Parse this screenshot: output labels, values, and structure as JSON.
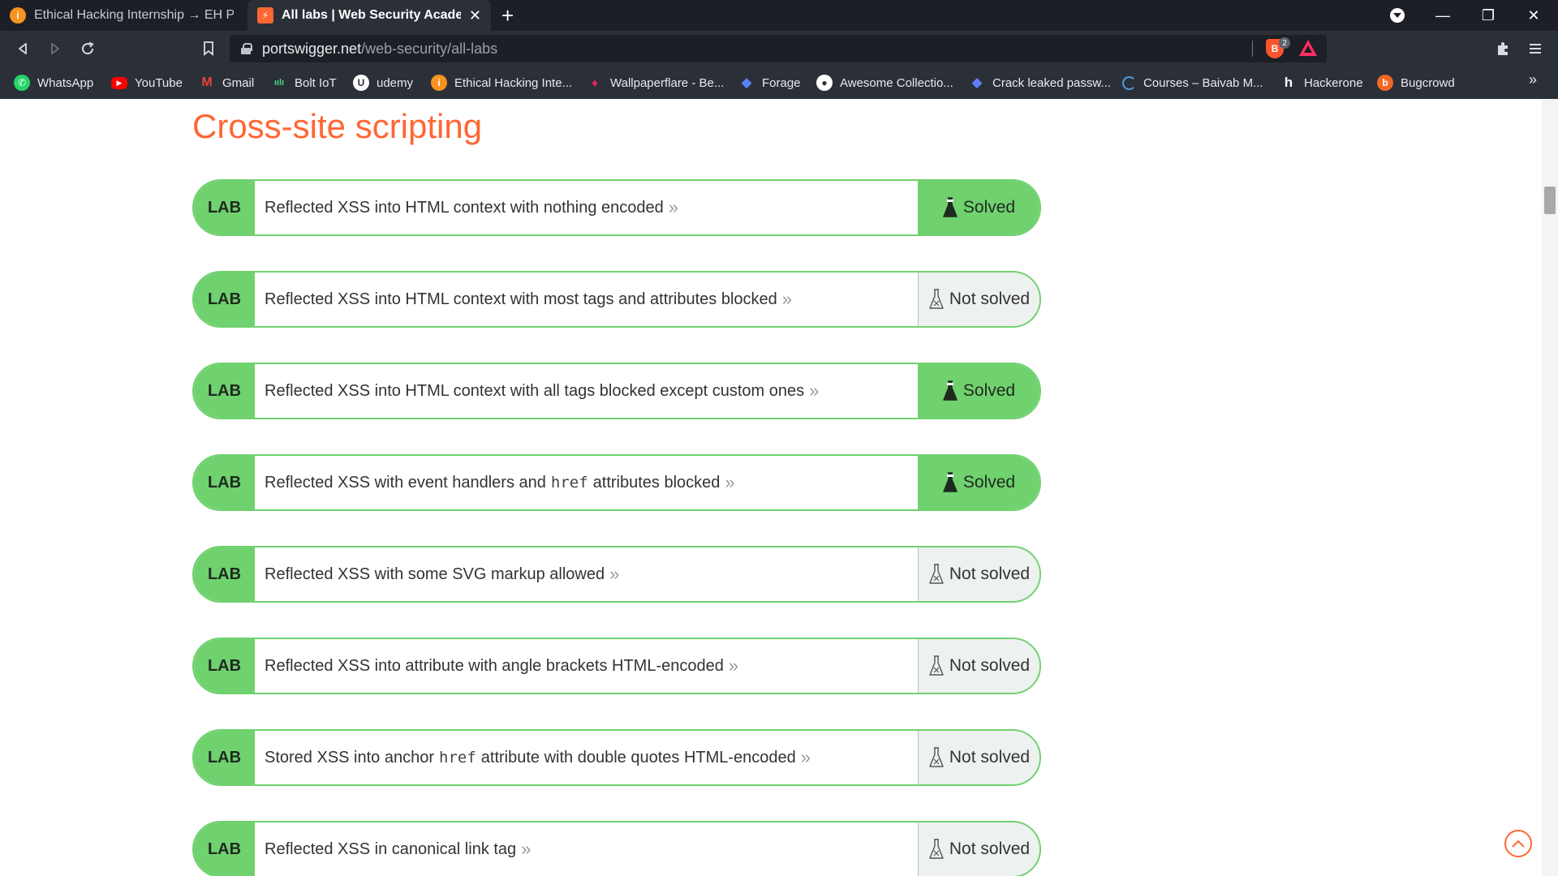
{
  "tabs": [
    {
      "title": "Ethical Hacking Internship → EH Projects",
      "icon": "internshala-icon"
    },
    {
      "title": "All labs | Web Security Academy",
      "icon": "portswigger-icon"
    }
  ],
  "tab_close": "✕",
  "new_tab": "+",
  "window": {
    "minimize": "—",
    "restore": "❐",
    "close": "✕"
  },
  "address": {
    "domain": "portswigger.net",
    "path": "/web-security/all-labs"
  },
  "extensions": {
    "brave_count": "2"
  },
  "bookmarks": [
    {
      "label": "WhatsApp",
      "icon": "whatsapp-icon",
      "color": "#25d366"
    },
    {
      "label": "YouTube",
      "icon": "youtube-icon",
      "color": "#ff0000"
    },
    {
      "label": "Gmail",
      "icon": "gmail-icon",
      "color": "#ea4335"
    },
    {
      "label": "Bolt IoT",
      "icon": "bolt-iot-icon",
      "color": "#3ddc84"
    },
    {
      "label": "udemy",
      "icon": "udemy-icon",
      "color": "#ffffff"
    },
    {
      "label": "Ethical Hacking Inte...",
      "icon": "internshala-icon",
      "color": "#f7931e"
    },
    {
      "label": "Wallpaperflare - Be...",
      "icon": "wallpaperflare-icon",
      "color": "#e0245e"
    },
    {
      "label": "Forage",
      "icon": "forage-icon",
      "color": "#5b7ff5"
    },
    {
      "label": "Awesome Collectio...",
      "icon": "github-icon",
      "color": "#ffffff"
    },
    {
      "label": "Crack leaked passw...",
      "icon": "crack-icon",
      "color": "#5b7ff5"
    },
    {
      "label": "Courses – Baivab M...",
      "icon": "courses-icon",
      "color": "#4a9de0"
    },
    {
      "label": "Hackerone",
      "icon": "hackerone-icon",
      "color": "#ffffff"
    },
    {
      "label": "Bugcrowd",
      "icon": "bugcrowd-icon",
      "color": "#f26822"
    }
  ],
  "bookmarks_more": "»",
  "section_title": "Cross-site scripting",
  "lab_tag": "LAB",
  "status_labels": {
    "solved": "Solved",
    "unsolved": "Not solved"
  },
  "labs": [
    {
      "parts": [
        {
          "t": "text",
          "v": "Reflected XSS into HTML context with nothing encoded"
        }
      ],
      "solved": true
    },
    {
      "parts": [
        {
          "t": "text",
          "v": "Reflected XSS into HTML context with most tags and attributes blocked"
        }
      ],
      "solved": false
    },
    {
      "parts": [
        {
          "t": "text",
          "v": "Reflected XSS into HTML context with all tags blocked except custom ones"
        }
      ],
      "solved": true
    },
    {
      "parts": [
        {
          "t": "text",
          "v": "Reflected XSS with event handlers and"
        },
        {
          "t": "code",
          "v": "href"
        },
        {
          "t": "text",
          "v": "attributes blocked"
        }
      ],
      "solved": true
    },
    {
      "parts": [
        {
          "t": "text",
          "v": "Reflected XSS with some SVG markup allowed"
        }
      ],
      "solved": false
    },
    {
      "parts": [
        {
          "t": "text",
          "v": "Reflected XSS into attribute with angle brackets HTML-encoded"
        }
      ],
      "solved": false
    },
    {
      "parts": [
        {
          "t": "text",
          "v": "Stored XSS into anchor"
        },
        {
          "t": "code",
          "v": "href"
        },
        {
          "t": "text",
          "v": "attribute with double quotes HTML-encoded"
        }
      ],
      "solved": false
    },
    {
      "parts": [
        {
          "t": "text",
          "v": "Reflected XSS in canonical link tag"
        }
      ],
      "solved": false
    }
  ],
  "colors": {
    "accent": "#ff6633",
    "lab_green": "#70d16f",
    "unsolved_bg": "#edf1ef"
  }
}
